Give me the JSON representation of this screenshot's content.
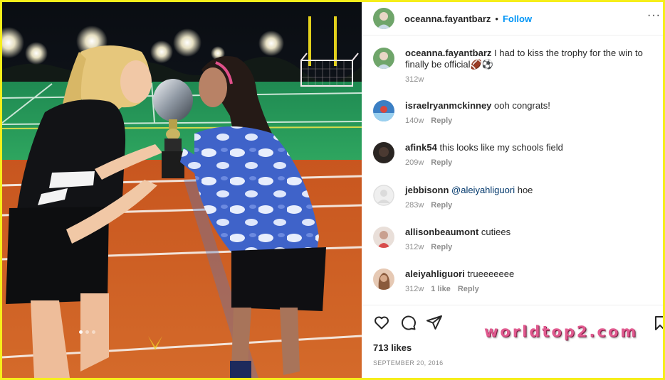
{
  "post": {
    "username": "oceanna.fayantbarz",
    "follow_label": "Follow",
    "more_label": "···",
    "caption": {
      "username": "oceanna.fayantbarz",
      "text": "I had to kiss the trophy for the win to finally be official🏈⚽",
      "time": "312w"
    },
    "comments": [
      {
        "username": "israelryanmckinney",
        "text": "ooh congrats!",
        "time": "140w",
        "likes": "",
        "reply": "Reply",
        "avatar_color": "#3b7fc4"
      },
      {
        "username": "afink54",
        "text": "this looks like my schools field",
        "time": "209w",
        "likes": "",
        "reply": "Reply",
        "avatar_color": "#2a2522"
      },
      {
        "username": "jebbisonn",
        "mention": "@aleiyahliguori",
        "text": "hoe",
        "time": "283w",
        "likes": "",
        "reply": "Reply",
        "avatar_color": "#dbdbdb"
      },
      {
        "username": "allisonbeaumont",
        "text": "cutiees",
        "time": "312w",
        "likes": "",
        "reply": "Reply",
        "avatar_color": "#c9a08f"
      },
      {
        "username": "aleiyahliguori",
        "text": "trueeeeeee",
        "time": "312w",
        "likes": "1 like",
        "reply": "Reply",
        "avatar_color": "#8a5a3c"
      }
    ],
    "likes_count": "713 likes",
    "date": "SEPTEMBER 20, 2016"
  },
  "icons": {
    "like": "heart-icon",
    "comment": "comment-icon",
    "share": "share-icon",
    "save": "bookmark-icon"
  },
  "watermark": "worldtop2.com",
  "colors": {
    "frame": "#f6ee1a",
    "follow": "#0095f6",
    "muted": "#8e8e8e",
    "mention": "#00376b",
    "watermark": "#e05a8f"
  }
}
